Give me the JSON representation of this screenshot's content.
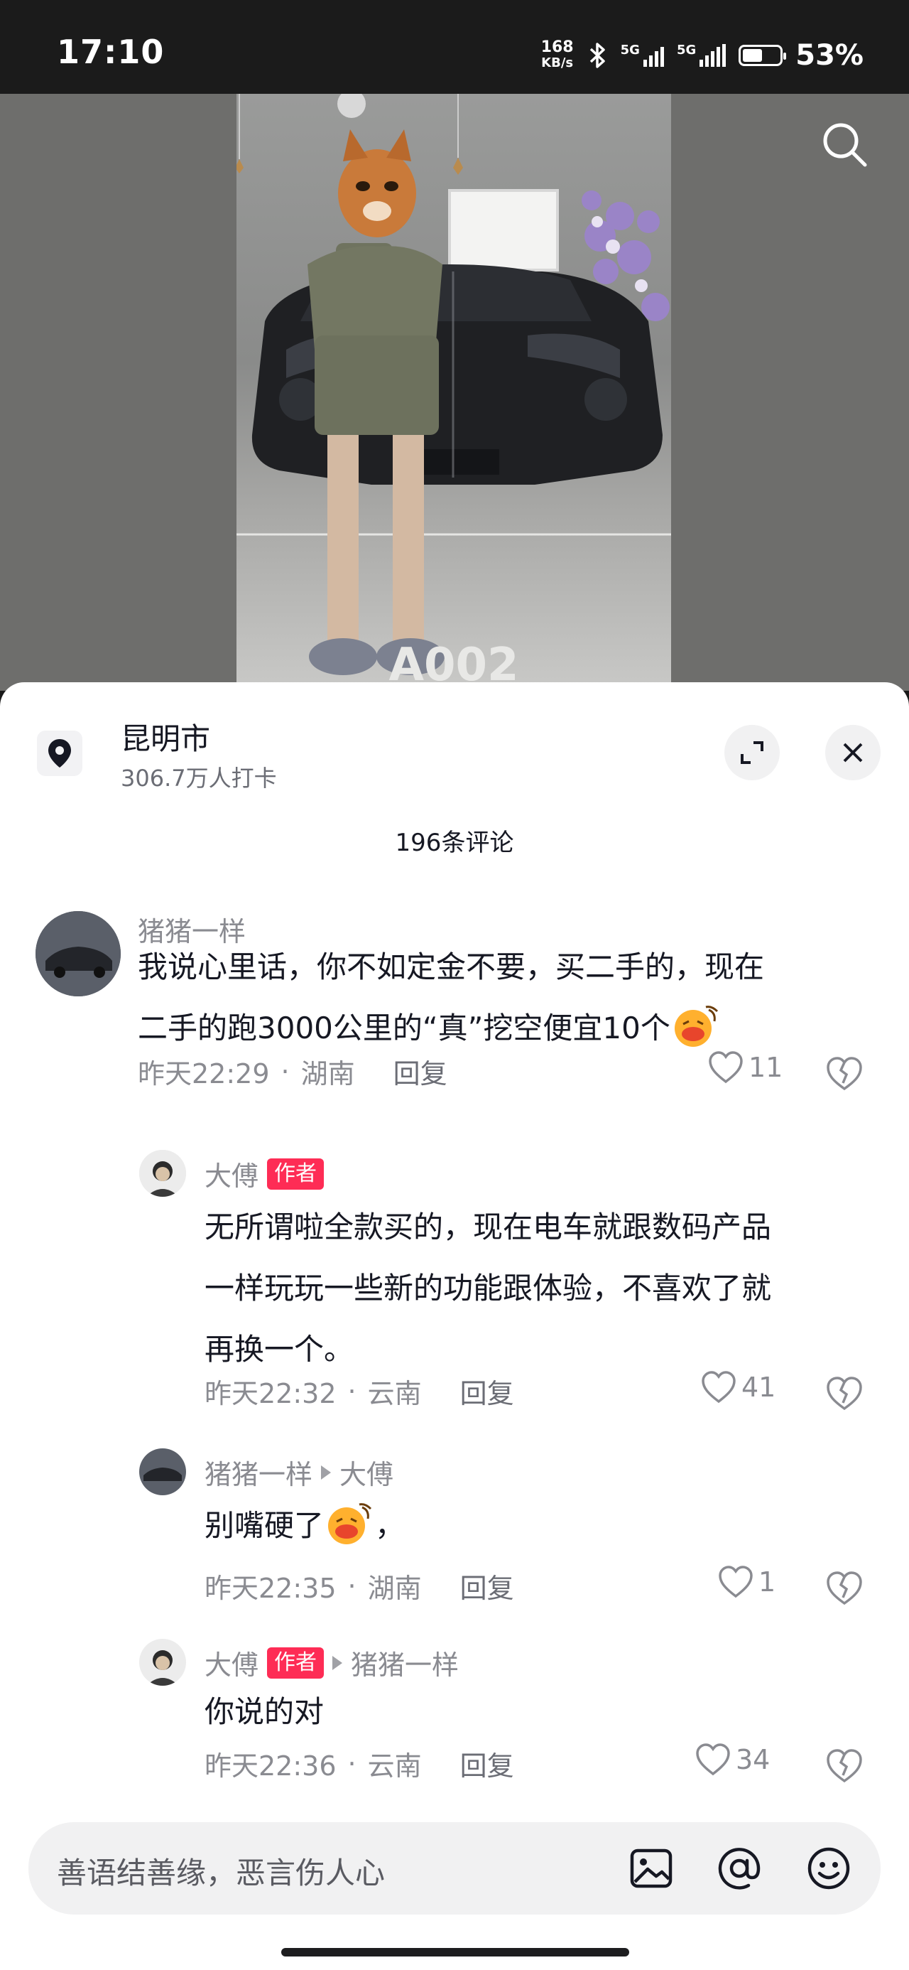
{
  "status_bar": {
    "time": "17:10",
    "net_speed_value": "168",
    "net_speed_unit": "KB/s",
    "sim1": "5G",
    "sim2": "5G",
    "battery": "53%",
    "battery_level": 0.53
  },
  "sheet": {
    "location_name": "昆明市",
    "location_sub": "306.7万人打卡",
    "comment_count": "196条评论"
  },
  "comments": [
    {
      "user": "猪猪一样",
      "text_line1": "我说心里话，你不如定金不要，买二手的，现在",
      "text_line2": "二手的跑3000公里的“真”挖空便宜10个",
      "time": "昨天22:29",
      "region": "湖南",
      "reply": "回复",
      "likes": "11"
    },
    {
      "user": "大傅",
      "tag": "作者",
      "text_line1": "无所谓啦全款买的，现在电车就跟数码产品",
      "text_line2": "一样玩玩一些新的功能跟体验，不喜欢了就",
      "text_line3": "再换一个。",
      "time": "昨天22:32",
      "region": "云南",
      "reply": "回复",
      "likes": "41"
    },
    {
      "user": "猪猪一样",
      "reply_to": "大傅",
      "text_before": "别嘴硬了",
      "text_after": "，",
      "time": "昨天22:35",
      "region": "湖南",
      "reply": "回复",
      "likes": "1"
    },
    {
      "user": "大傅",
      "tag": "作者",
      "reply_to": "猪猪一样",
      "text": "你说的对",
      "time": "昨天22:36",
      "region": "云南",
      "reply": "回复",
      "likes": "34"
    }
  ],
  "input": {
    "placeholder": "善语结善缘，恶言伤人心"
  },
  "icons": [
    "search-icon",
    "location-pin-icon",
    "expand-icon",
    "close-icon",
    "heart-icon",
    "dislike-icon",
    "image-icon",
    "at-icon",
    "emoji-icon"
  ]
}
